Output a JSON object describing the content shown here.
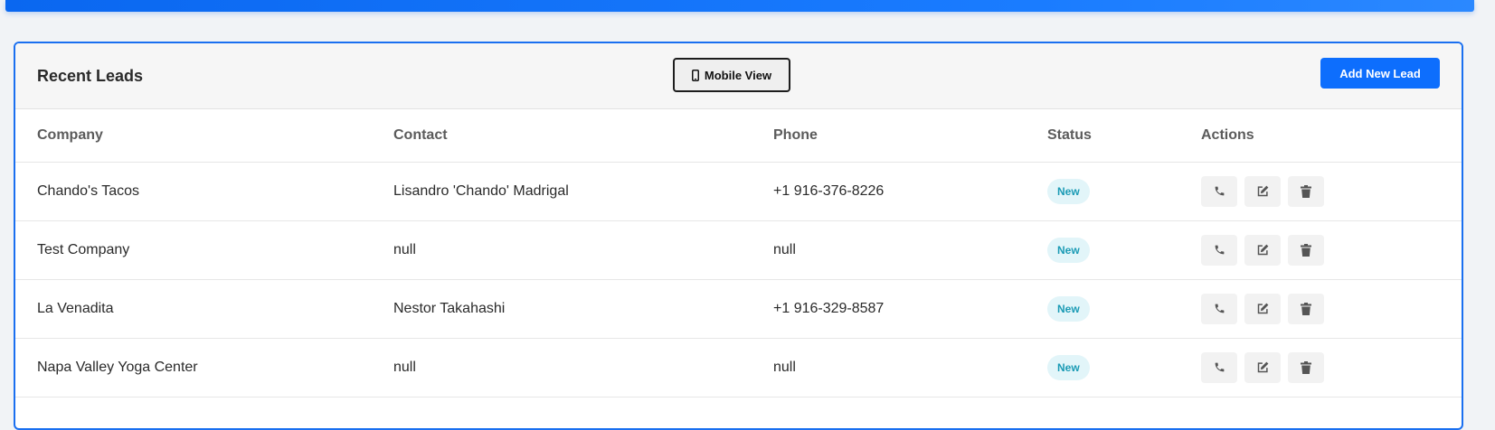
{
  "card": {
    "title": "Recent Leads",
    "mobile_view_label": "Mobile View",
    "add_lead_label": "Add New Lead"
  },
  "table": {
    "headers": [
      "Company",
      "Contact",
      "Phone",
      "Status",
      "Actions"
    ],
    "rows": [
      {
        "company": "Chando's Tacos",
        "contact": "Lisandro 'Chando' Madrigal",
        "phone": "+1 916-376-8226",
        "status": "New"
      },
      {
        "company": "Test Company",
        "contact": "null",
        "phone": "null",
        "status": "New"
      },
      {
        "company": "La Venadita",
        "contact": "Nestor Takahashi",
        "phone": "+1 916-329-8587",
        "status": "New"
      },
      {
        "company": "Napa Valley Yoga Center",
        "contact": "null",
        "phone": "null",
        "status": "New"
      }
    ],
    "row_actions": [
      "phone-icon",
      "edit-icon",
      "trash-icon"
    ]
  },
  "colors": {
    "accent": "#0d6efd",
    "status_new_bg": "#e2f5f9",
    "status_new_text": "#1b9bb5"
  }
}
